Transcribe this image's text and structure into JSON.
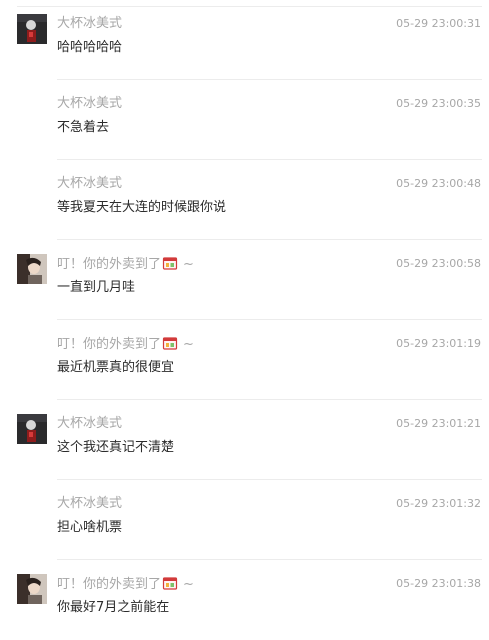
{
  "messages": [
    {
      "sender": "大杯冰美式",
      "sender_emoji": false,
      "show_avatar": true,
      "avatar": "avatar-dark-figure",
      "time": "05-29 23:00:31",
      "text": "哈哈哈哈哈"
    },
    {
      "sender": "大杯冰美式",
      "sender_emoji": false,
      "show_avatar": false,
      "avatar": "",
      "time": "05-29 23:00:35",
      "text": "不急着去"
    },
    {
      "sender": "大杯冰美式",
      "sender_emoji": false,
      "show_avatar": false,
      "avatar": "",
      "time": "05-29 23:00:48",
      "text": "等我夏天在大连的时候跟你说"
    },
    {
      "sender": "叮！你的外卖到了",
      "sender_emoji": true,
      "sender_suffix": "~",
      "show_avatar": true,
      "avatar": "avatar-girl-photo",
      "time": "05-29 23:00:58",
      "text": "一直到几月哇"
    },
    {
      "sender": "叮！你的外卖到了",
      "sender_emoji": true,
      "sender_suffix": "~",
      "show_avatar": false,
      "avatar": "",
      "time": "05-29 23:01:19",
      "text": "最近机票真的很便宜"
    },
    {
      "sender": "大杯冰美式",
      "sender_emoji": false,
      "show_avatar": true,
      "avatar": "avatar-dark-figure",
      "time": "05-29 23:01:21",
      "text": "这个我还真记不清楚"
    },
    {
      "sender": "大杯冰美式",
      "sender_emoji": false,
      "show_avatar": false,
      "avatar": "",
      "time": "05-29 23:01:32",
      "text": "担心啥机票"
    },
    {
      "sender": "叮！你的外卖到了",
      "sender_emoji": true,
      "sender_suffix": "~",
      "show_avatar": true,
      "avatar": "avatar-girl-photo",
      "time": "05-29 23:01:38",
      "text": "你最好7月之前能在"
    }
  ],
  "colors": {
    "meta_text": "#a7a7a7",
    "body_text": "#2b2b2b",
    "divider": "#ececec",
    "bento_red": "#d23a3a"
  }
}
